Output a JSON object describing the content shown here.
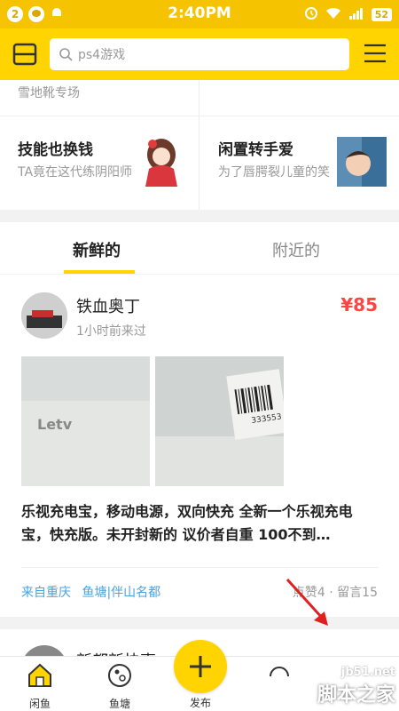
{
  "status_bar": {
    "notif_count": "2",
    "time": "2:40PM",
    "battery": "52"
  },
  "header": {
    "search_placeholder": "ps4游戏"
  },
  "categories": {
    "top_left_partial": "雪地靴专场",
    "cells": [
      {
        "title": "技能也换钱",
        "subtitle": "TA竟在这代练阴阳师"
      },
      {
        "title": "闲置转手爱",
        "subtitle": "为了唇腭裂儿童的笑"
      }
    ]
  },
  "tabs": [
    {
      "label": "新鲜的",
      "active": true
    },
    {
      "label": "附近的",
      "active": false
    }
  ],
  "post": {
    "username": "铁血奥丁",
    "time_ago": "1小时前来过",
    "price": "¥85",
    "description": "乐视充电宝，移动电源，双向快充 全新一个乐视充电宝，快充版。未开封新的 议价者自重 100不到…",
    "location": "来自重庆",
    "pond": "鱼塘|伴山名都",
    "stats": "点赞4 · 留言15",
    "photo_brand": "Letv",
    "photo_code": "333553"
  },
  "next_post": {
    "username": "新都新快事"
  },
  "bottom_nav": {
    "home": "闲鱼",
    "pond": "鱼塘",
    "publish": "发布"
  },
  "watermark": {
    "url": "jb51.net",
    "name": "脚本之家"
  },
  "colors": {
    "brand_yellow": "#ffd400",
    "price_red": "#ff4444",
    "link_blue": "#4aa3df"
  }
}
